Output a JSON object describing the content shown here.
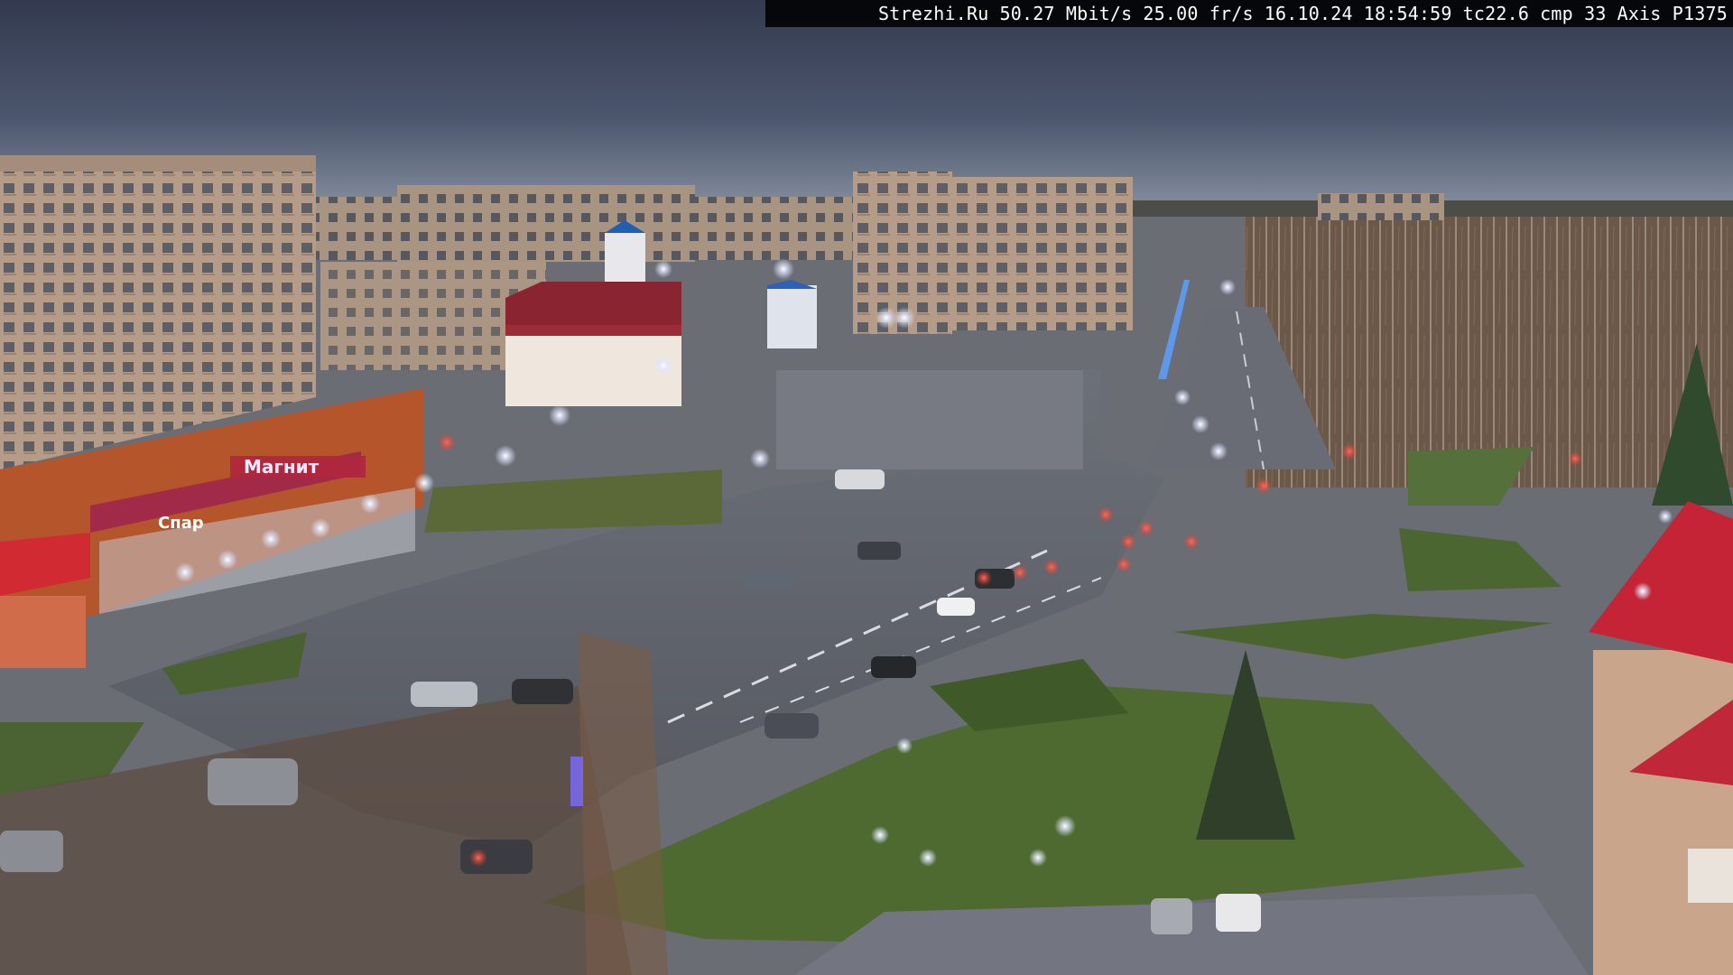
{
  "overlay": {
    "site": "Strezhi.Ru",
    "bitrate": "50.27 Mbit/s",
    "framerate": "25.00 fr/s",
    "date": "16.10.24",
    "time": "18:54:59",
    "tc": "tc22.6",
    "cmp": "cmp 33",
    "camera": "Axis P1375"
  },
  "signs": {
    "store_name": "Магнит",
    "store_name_2": "Спар"
  },
  "colors": {
    "sky_top": "#363d54",
    "sky_horizon": "#7d8696",
    "road": "#5d6069",
    "grass": "#4f6a32",
    "building_brick": "#b99d86",
    "store_red": "#a32a2a",
    "roof_red": "#c02434",
    "streetlight": "#f5f7ff"
  }
}
